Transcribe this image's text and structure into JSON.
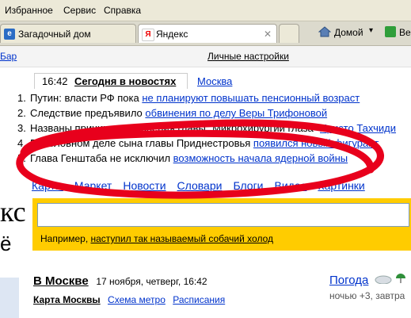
{
  "menu": {
    "favorites": "Избранное",
    "service": "Сервис",
    "help": "Справка"
  },
  "tabs": [
    {
      "label": "Загадочный дом",
      "icon": "ie-icon"
    },
    {
      "label": "Яндекс",
      "icon": "yandex-icon",
      "close": "✕"
    }
  ],
  "toolbar": {
    "home": "Домой",
    "cut": "Ве"
  },
  "links_bar": {
    "left": "Бар",
    "personal": "Личные настройки"
  },
  "news": {
    "time": "16:42",
    "tab_today": "Сегодня в новостях",
    "tab_moscow": "Москва",
    "items": [
      {
        "num": "1.",
        "text": "Путин: власти РФ пока ",
        "link": "не планируют повышать пенсионный возраст"
      },
      {
        "num": "2.",
        "text": "Следствие предъявило ",
        "link": "обвинения по делу Веры Трифоновой"
      },
      {
        "num": "3.",
        "text": "Названы причины увольнения главы \"Микрохирургии глаза\" ",
        "link": "Христо Тахчиди"
      },
      {
        "num": "4.",
        "text": "В уголовном деле сына главы Приднестровья ",
        "link": "появился новый фигурант"
      },
      {
        "num": "5.",
        "text": "Глава Генштаба не исключил ",
        "link": "возможность начала ядерной войны"
      }
    ]
  },
  "services": [
    "Карты",
    "Маркет",
    "Новости",
    "Словари",
    "Блоги",
    "Видео",
    "Картинки"
  ],
  "search": {
    "value": "",
    "example_prefix": "Например, ",
    "example_link": "наступил так называемый собачий холод"
  },
  "logo": {
    "fragment1": "кс",
    "fragment2": "ё"
  },
  "moscow": {
    "title": "В Москве",
    "date": "17 ноября, четверг, 16:42",
    "links": [
      "Карта Москвы",
      "Схема метро",
      "Расписания"
    ]
  },
  "weather": {
    "title": "Погода",
    "forecast": "ночью +3, завтра"
  },
  "colors": {
    "accent_search": "#ffcc00",
    "link": "#0033cc",
    "scribble": "#e8001c"
  }
}
